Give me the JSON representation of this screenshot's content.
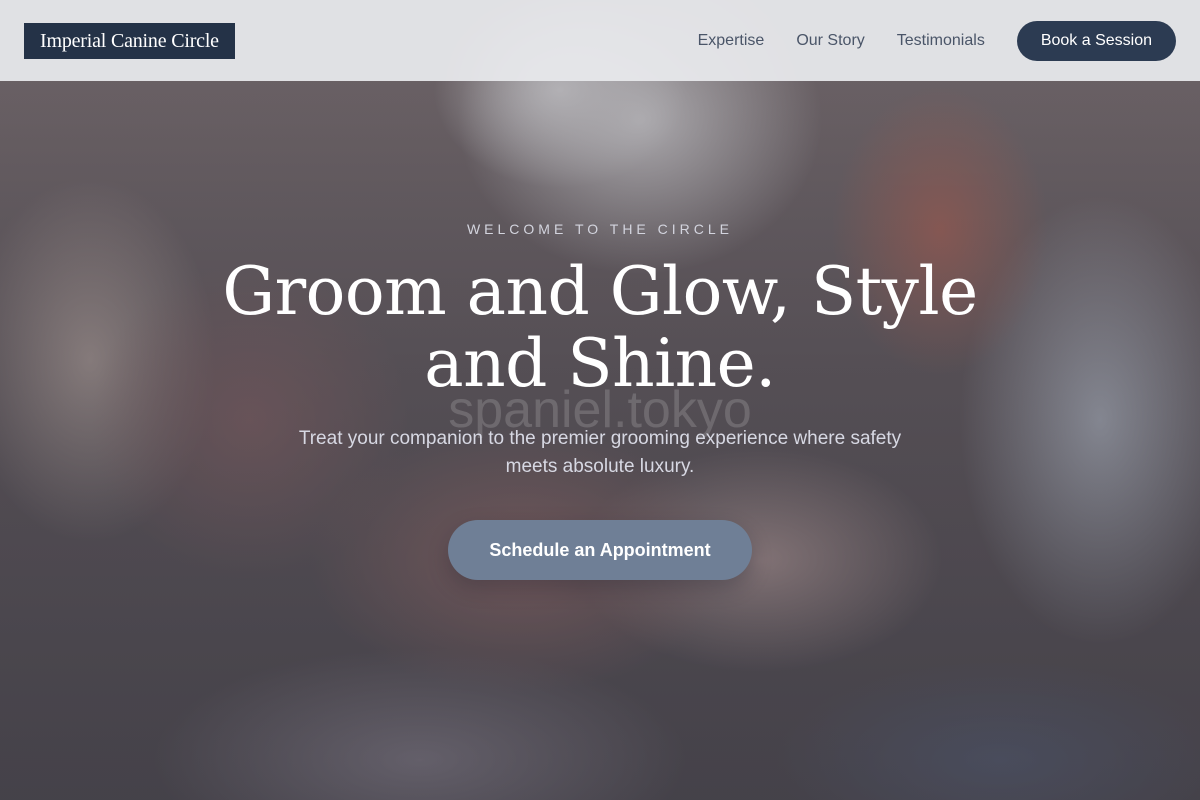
{
  "header": {
    "logo": "Imperial Canine Circle",
    "nav": [
      {
        "label": "Expertise"
      },
      {
        "label": "Our Story"
      },
      {
        "label": "Testimonials"
      }
    ],
    "cta_label": "Book a Session"
  },
  "hero": {
    "eyebrow": "WELCOME TO THE CIRCLE",
    "headline": "Groom and Glow, Style and Shine.",
    "watermark": "spaniel.tokyo",
    "subtext": "Treat your companion to the premier grooming experience where safety meets absolute luxury.",
    "cta_label": "Schedule an Appointment"
  },
  "colors": {
    "brand_dark": "#243247",
    "button_primary": "#2c3b52",
    "cta_button": "#6f7f96",
    "header_bg": "#e8e9ec"
  }
}
